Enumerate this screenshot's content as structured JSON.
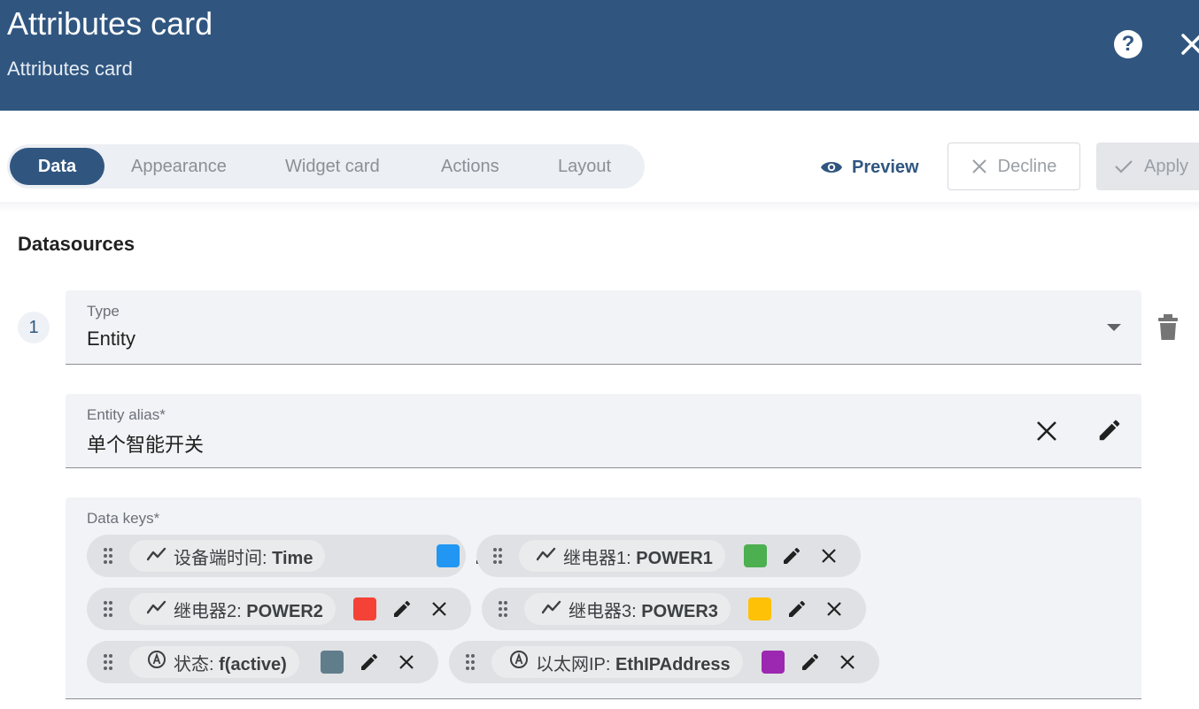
{
  "header": {
    "title": "Attributes card",
    "subtitle": "Attributes card",
    "help_icon": "help-icon",
    "close_icon": "close-icon"
  },
  "tabs": [
    {
      "label": "Data",
      "active": true
    },
    {
      "label": "Appearance",
      "active": false
    },
    {
      "label": "Widget card",
      "active": false
    },
    {
      "label": "Actions",
      "active": false
    },
    {
      "label": "Layout",
      "active": false
    }
  ],
  "actions": {
    "preview": "Preview",
    "decline": "Decline",
    "apply": "Apply"
  },
  "datasources": {
    "title": "Datasources",
    "items": [
      {
        "index": "1",
        "type": {
          "label": "Type",
          "value": "Entity"
        },
        "entity_alias": {
          "label": "Entity alias*",
          "value": "单个智能开关"
        },
        "data_keys": {
          "label": "Data keys*",
          "chips": [
            {
              "icon": "timeseries-icon",
              "name": "设备端时间: ",
              "key": "Time",
              "color": "#2196f3"
            },
            {
              "icon": "timeseries-icon",
              "name": "继电器1: ",
              "key": "POWER1",
              "color": "#4caf50"
            },
            {
              "icon": "timeseries-icon",
              "name": "继电器2: ",
              "key": "POWER2",
              "color": "#f44336"
            },
            {
              "icon": "timeseries-icon",
              "name": "继电器3: ",
              "key": "POWER3",
              "color": "#ffc107"
            },
            {
              "icon": "attribute-icon",
              "name": "状态: ",
              "key": "f(active)",
              "color": "#607d8b"
            },
            {
              "icon": "attribute-icon",
              "name": "以太网IP: ",
              "key": "EthIPAddress",
              "color": "#9c27b0"
            }
          ]
        }
      }
    ]
  }
}
